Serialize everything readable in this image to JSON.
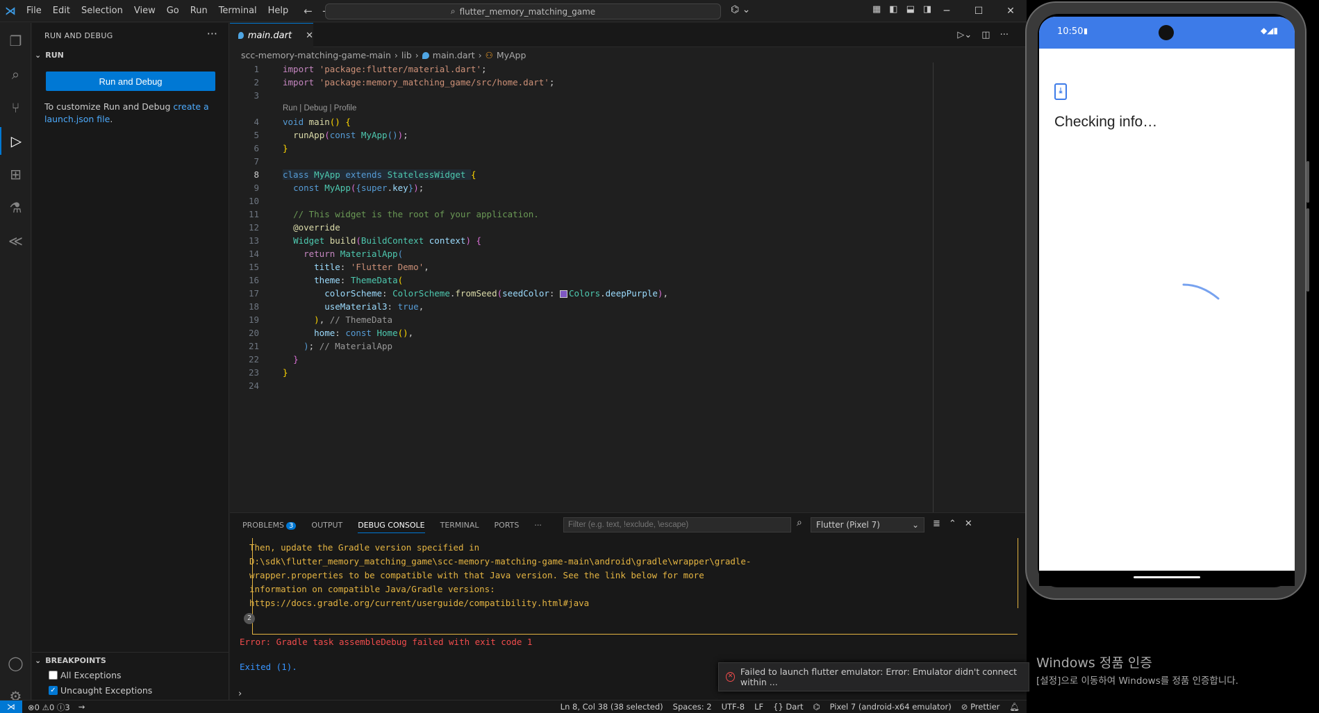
{
  "titlebar": {
    "menu": [
      "File",
      "Edit",
      "Selection",
      "View",
      "Go",
      "Run",
      "Terminal",
      "Help"
    ],
    "search": "flutter_memory_matching_game"
  },
  "sidebar": {
    "title": "RUN AND DEBUG",
    "section": "RUN",
    "run_button": "Run and Debug",
    "customize_text": "To customize Run and Debug",
    "customize_link": "create a launch.json file",
    "customize_end": ".",
    "breakpoints_title": "BREAKPOINTS",
    "breakpoints": [
      {
        "label": "All Exceptions",
        "checked": false
      },
      {
        "label": "Uncaught Exceptions",
        "checked": true
      }
    ]
  },
  "editor": {
    "tab": "main.dart",
    "breadcrumb": [
      "scc-memory-matching-game-main",
      "lib",
      "main.dart",
      "MyApp"
    ],
    "codelens": "Run | Debug | Profile",
    "line_numbers": [
      "1",
      "2",
      "3",
      "4",
      "5",
      "6",
      "7",
      "8",
      "9",
      "10",
      "11",
      "12",
      "13",
      "14",
      "15",
      "16",
      "17",
      "18",
      "19",
      "20",
      "21",
      "22",
      "23",
      "24"
    ]
  },
  "panel": {
    "tabs": [
      "PROBLEMS",
      "OUTPUT",
      "DEBUG CONSOLE",
      "TERMINAL",
      "PORTS"
    ],
    "problems_count": "3",
    "filter_placeholder": "Filter (e.g. text, !exclude, \\escape)",
    "select_value": "Flutter (Pixel 7)",
    "console_lines": [
      "Then, update the Gradle version specified in",
      "D:\\sdk\\flutter_memory_matching_game\\scc-memory-matching-game-main\\android\\gradle\\wrapper\\gradle-",
      "wrapper.properties to be compatible with that Java version. See the link below for more",
      "information on compatible Java/Gradle versions:",
      "https://docs.gradle.org/current/userguide/compatibility.html#java"
    ],
    "repeat_count": "2",
    "error_line": "Error: Gradle task assembleDebug failed with exit code 1",
    "exited_line": "Exited (1)."
  },
  "notification": {
    "message": "Failed to launch flutter emulator: Error: Emulator didn't connect within ..."
  },
  "statusbar": {
    "errors": "0",
    "warnings": "0",
    "info": "3",
    "position": "Ln 8, Col 38 (38 selected)",
    "spaces": "Spaces: 2",
    "encoding": "UTF-8",
    "eol": "LF",
    "language": "Dart",
    "device": "Pixel 7 (android-x64 emulator)",
    "formatter": "Prettier"
  },
  "emulator": {
    "time": "10:50",
    "message": "Checking info…"
  },
  "windows_activation": {
    "title": "Windows 정품 인증",
    "subtitle": "[설정]으로 이동하여 Windows를 정품 인증합니다."
  },
  "colors": {
    "accent": "#0078d4",
    "error": "#f14c4c",
    "warning": "#e5b542",
    "android_blue": "#3d7be8"
  }
}
